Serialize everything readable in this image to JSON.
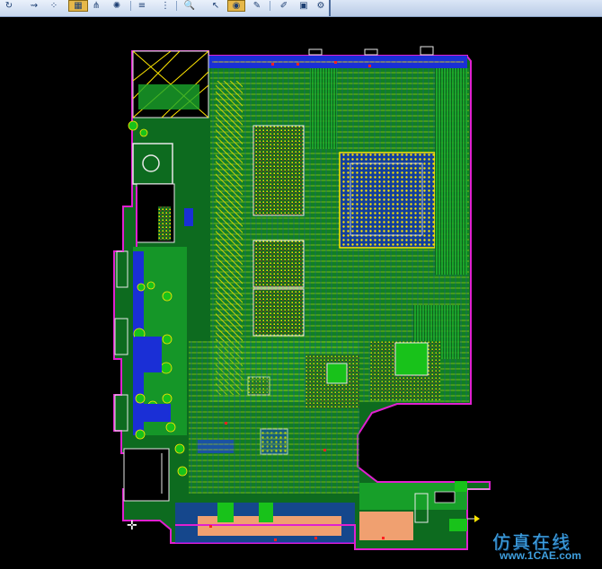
{
  "toolbar": {
    "buttons": [
      {
        "name": "rotate-icon",
        "glyph": "↻"
      },
      {
        "name": "route-icon",
        "glyph": "⇝"
      },
      {
        "name": "dots-icon",
        "glyph": "⁘"
      },
      {
        "name": "board-icon",
        "glyph": "▦"
      },
      {
        "name": "tree-icon",
        "glyph": "⋔"
      },
      {
        "name": "sun-icon",
        "glyph": "✺"
      },
      {
        "name": "layer-icon",
        "glyph": "≡"
      },
      {
        "name": "grid-icon",
        "glyph": "⋮"
      },
      {
        "name": "zoom-icon",
        "glyph": "🔍"
      },
      {
        "name": "cursor-icon",
        "glyph": "↖"
      },
      {
        "name": "highlight-icon",
        "glyph": "◉"
      },
      {
        "name": "pen-icon",
        "glyph": "✎"
      },
      {
        "name": "edit-icon",
        "glyph": "✐"
      },
      {
        "name": "color-icon",
        "glyph": "▣"
      },
      {
        "name": "settings-icon",
        "glyph": "⚙"
      }
    ]
  },
  "watermark": {
    "chinese": "仿真在线",
    "url": "www.1CAE.com"
  },
  "colors": {
    "background": "#000000",
    "board_fill": "#0d6b1f",
    "copper_green": "#1aa82c",
    "pads_yellow": "#ffe600",
    "traces_blue": "#1a2fd6",
    "outline_magenta": "#e020d0",
    "silk_white": "#e8e8e8",
    "red_marks": "#ff2020"
  }
}
